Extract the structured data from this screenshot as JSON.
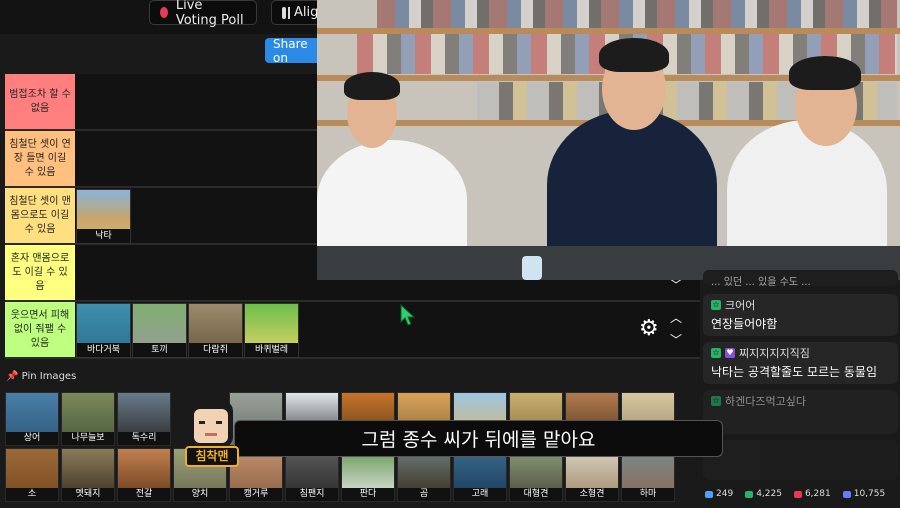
{
  "toolbar": {
    "live_voting_label": "Live Voting Poll",
    "align_label": "Alig",
    "share_label": "Share on"
  },
  "tiers": [
    {
      "label": "범접조차 할 수 없음",
      "color": "#ff7f7f"
    },
    {
      "label": "침철단 셋이 연장 들면 이길 수 있음",
      "color": "#ffbf7f"
    },
    {
      "label": "침철단 셋이 맨몸으로도 이길 수 있음",
      "color": "#ffdf7f"
    },
    {
      "label": "혼자 맨몸으로도 이길 수 있음",
      "color": "#ffff7f"
    },
    {
      "label": "웃으면서 피해 없이 줘팰 수 있음",
      "color": "#bfff7f"
    }
  ],
  "tier_items": {
    "tier3": [
      {
        "label": "낙타"
      }
    ],
    "tier5": [
      {
        "label": "바다거북"
      },
      {
        "label": "토끼"
      },
      {
        "label": "다람쥐"
      },
      {
        "label": "바퀴벌레"
      }
    ]
  },
  "pin_title": "Pin Images",
  "pin_row1": [
    "상어",
    "나무늘보",
    "독수리",
    "",
    "",
    "",
    "",
    "",
    "",
    "",
    "",
    ""
  ],
  "pin_row2": [
    "소",
    "멧돼지",
    "전갈",
    "양치",
    "캥거루",
    "침팬지",
    "판다",
    "곰",
    "고래",
    "대형견",
    "소형견",
    "하마"
  ],
  "subtitle": "그럼 종수 씨가 뒤에를 맡아요",
  "character_name": "침착맨",
  "chat": [
    {
      "user": "",
      "text": "... 있던 ... 있을 수도 ..."
    },
    {
      "user": "크어어",
      "text": "연장들어야함",
      "heart": false
    },
    {
      "user": "찌지지지지직짐",
      "text": "낙타는 공격할줄도 모르는 동물임",
      "heart": true
    },
    {
      "user": "하겐다즈먹고싶다",
      "text": "",
      "heart": false
    },
    {
      "user": "",
      "text": "...",
      "heart": false
    }
  ],
  "stats": {
    "a": "249",
    "b": "4,225",
    "c": "6,281",
    "d": "10,755"
  },
  "colors": {
    "share": "#2a8ae6",
    "subtitle_border": "#555555",
    "character_accent": "#f2b01e"
  }
}
